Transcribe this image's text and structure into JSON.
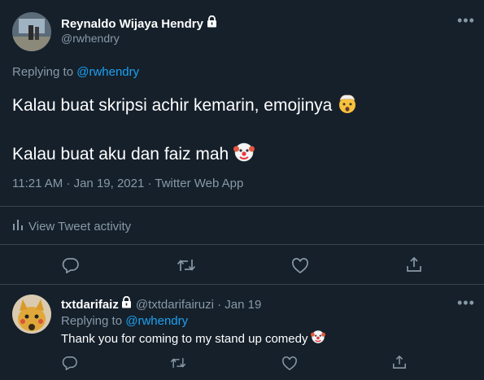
{
  "main_tweet": {
    "display_name": "Reynaldo Wijaya Hendry",
    "handle": "@rwhendry",
    "replying_prefix": "Replying to",
    "replying_handle": "@rwhendry",
    "line1": "Kalau buat skripsi achir kemarin, emojinya",
    "line1_emoji": "exploding-head-emoji",
    "line2": "Kalau buat aku dan faiz mah",
    "line2_emoji": "clown-face-emoji",
    "meta": "11:21 AM · Jan 19, 2021 · Twitter Web App",
    "activity_label": "View Tweet activity"
  },
  "reply_tweet": {
    "display_name": "txtdarifaiz",
    "handle_date": "@txtdarifairuzi · Jan 19",
    "replying_prefix": "Replying to",
    "replying_handle": "@rwhendry",
    "text": "Thank you for coming to my stand up comedy",
    "text_emoji": "clown-face-emoji"
  },
  "icons": [
    "lock-icon",
    "more-icon",
    "reply-icon",
    "retweet-icon",
    "like-icon",
    "share-icon",
    "activity-icon"
  ],
  "colors": {
    "background": "#15202b",
    "link": "#1da1f2",
    "muted": "#8899a6",
    "divider": "#38444d"
  }
}
